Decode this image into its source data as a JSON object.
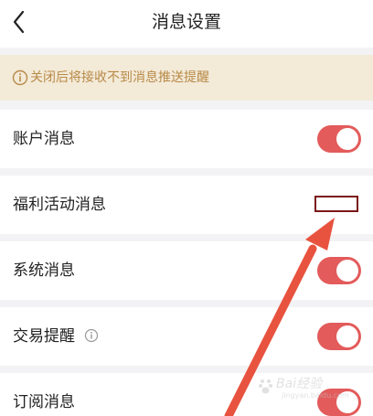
{
  "header": {
    "title": "消息设置",
    "back_icon": "chevron-left-icon"
  },
  "notice": {
    "text": "关闭后将接收不到消息推送提醒",
    "icon": "info-circle-icon",
    "color": "#b88a47",
    "background": "#f3ead8"
  },
  "settings": [
    {
      "label": "账户消息",
      "on": true
    },
    {
      "label": "福利活动消息",
      "on": false
    },
    {
      "label": "系统消息",
      "on": true
    },
    {
      "label": "交易提醒",
      "on": true,
      "has_info_icon": true
    },
    {
      "label": "订阅消息",
      "on": true
    }
  ],
  "colors": {
    "toggle_on": "#e35b5b",
    "highlight_box": "#7b1717",
    "arrow": "#e8533f"
  },
  "watermark": {
    "text": "Bai经验",
    "sub": "jingyan.baidu.com"
  }
}
